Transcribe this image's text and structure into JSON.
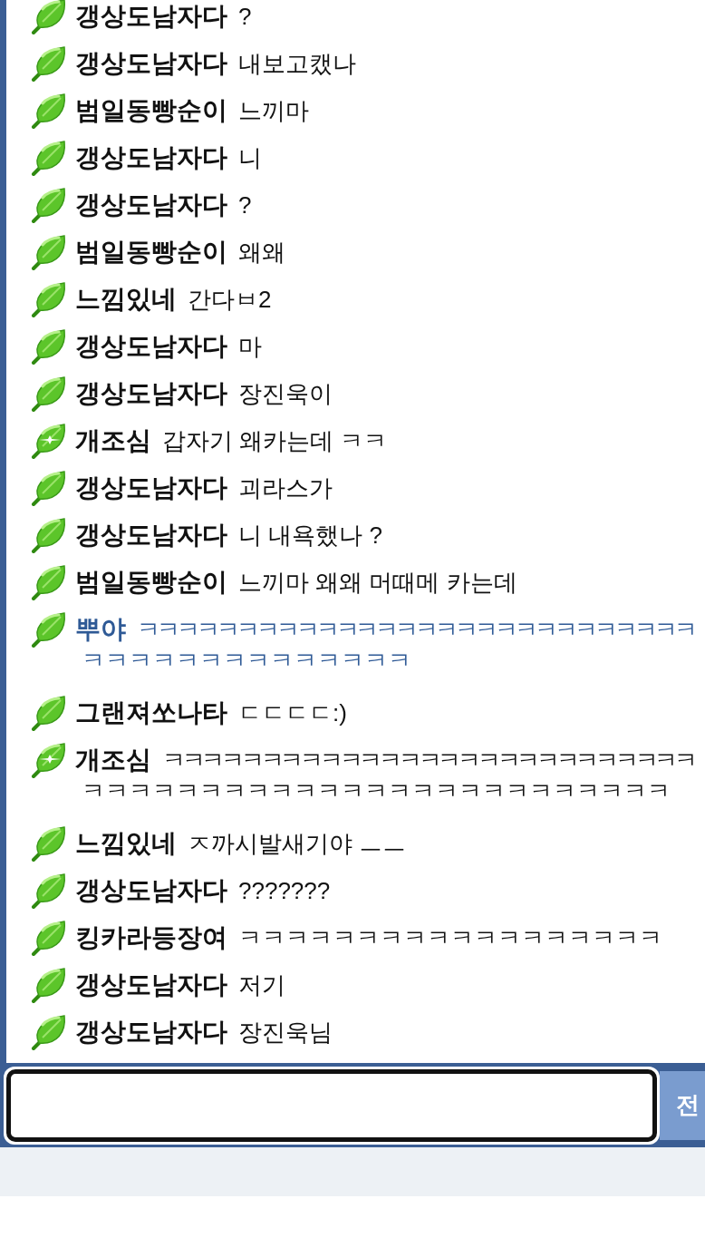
{
  "messages": [
    {
      "sparkle": false,
      "name": "갱상도남자다",
      "lines": [
        "?"
      ],
      "color": "#111111"
    },
    {
      "sparkle": false,
      "name": "갱상도남자다",
      "lines": [
        "내보고캤나"
      ],
      "color": "#111111"
    },
    {
      "sparkle": false,
      "name": "범일동빵순이",
      "lines": [
        "느끼마"
      ],
      "color": "#111111"
    },
    {
      "sparkle": false,
      "name": "갱상도남자다",
      "lines": [
        "니"
      ],
      "color": "#111111"
    },
    {
      "sparkle": false,
      "name": "갱상도남자다",
      "lines": [
        "?"
      ],
      "color": "#111111"
    },
    {
      "sparkle": false,
      "name": "범일동빵순이",
      "lines": [
        "왜왜"
      ],
      "color": "#111111"
    },
    {
      "sparkle": false,
      "name": "느낌있네",
      "lines": [
        "간다ㅂ2"
      ],
      "color": "#111111"
    },
    {
      "sparkle": false,
      "name": "갱상도남자다",
      "lines": [
        "마"
      ],
      "color": "#111111"
    },
    {
      "sparkle": false,
      "name": "갱상도남자다",
      "lines": [
        "장진욱이"
      ],
      "color": "#111111"
    },
    {
      "sparkle": true,
      "name": "개조심",
      "lines": [
        "갑자기 왜카는데 ㅋㅋ"
      ],
      "color": "#111111"
    },
    {
      "sparkle": false,
      "name": "갱상도남자다",
      "lines": [
        "괴라스가"
      ],
      "color": "#111111"
    },
    {
      "sparkle": false,
      "name": "갱상도남자다",
      "lines": [
        "니 내욕했나 ?"
      ],
      "color": "#111111"
    },
    {
      "sparkle": false,
      "name": "범일동빵순이",
      "lines": [
        "느끼마 왜왜 머때메 카는데"
      ],
      "color": "#111111"
    },
    {
      "sparkle": false,
      "name": "뿌야",
      "lines": [
        "ㅋㅋㅋㅋㅋㅋㅋㅋㅋㅋㅋㅋㅋㅋㅋㅋㅋㅋㅋㅋㅋㅋㅋㅋㅋㅋㅋㅋ",
        "ㅋㅋㅋㅋㅋㅋㅋㅋㅋㅋㅋㅋㅋㅋ"
      ],
      "color": "#2f5a96"
    },
    {
      "sparkle": false,
      "name": "그랜져쏘나타",
      "lines": [
        "ㄷㄷㄷㄷ:)"
      ],
      "color": "#111111"
    },
    {
      "sparkle": true,
      "name": "개조심",
      "lines": [
        "ㅋㅋㅋㅋㅋㅋㅋㅋㅋㅋㅋㅋㅋㅋㅋㅋㅋㅋㅋㅋㅋㅋㅋㅋㅋㅋㅋ",
        "ㅋㅋㅋㅋㅋㅋㅋㅋㅋㅋㅋㅋㅋㅋㅋㅋㅋㅋㅋㅋㅋㅋㅋㅋㅋ"
      ],
      "color": "#111111"
    },
    {
      "sparkle": false,
      "name": "느낌있네",
      "lines": [
        "ㅈ까시발새기야 ㅡㅡ"
      ],
      "color": "#111111"
    },
    {
      "sparkle": false,
      "name": "갱상도남자다",
      "lines": [
        "???????"
      ],
      "color": "#111111"
    },
    {
      "sparkle": false,
      "name": "킹카라등장여",
      "lines": [
        "ㅋㅋㅋㅋㅋㅋㅋㅋㅋㅋㅋㅋㅋㅋㅋㅋㅋㅋ"
      ],
      "color": "#111111"
    },
    {
      "sparkle": false,
      "name": "갱상도남자다",
      "lines": [
        "저기"
      ],
      "color": "#111111"
    },
    {
      "sparkle": false,
      "name": "갱상도남자다",
      "lines": [
        "장진욱님"
      ],
      "color": "#111111"
    }
  ],
  "send_button": "전"
}
